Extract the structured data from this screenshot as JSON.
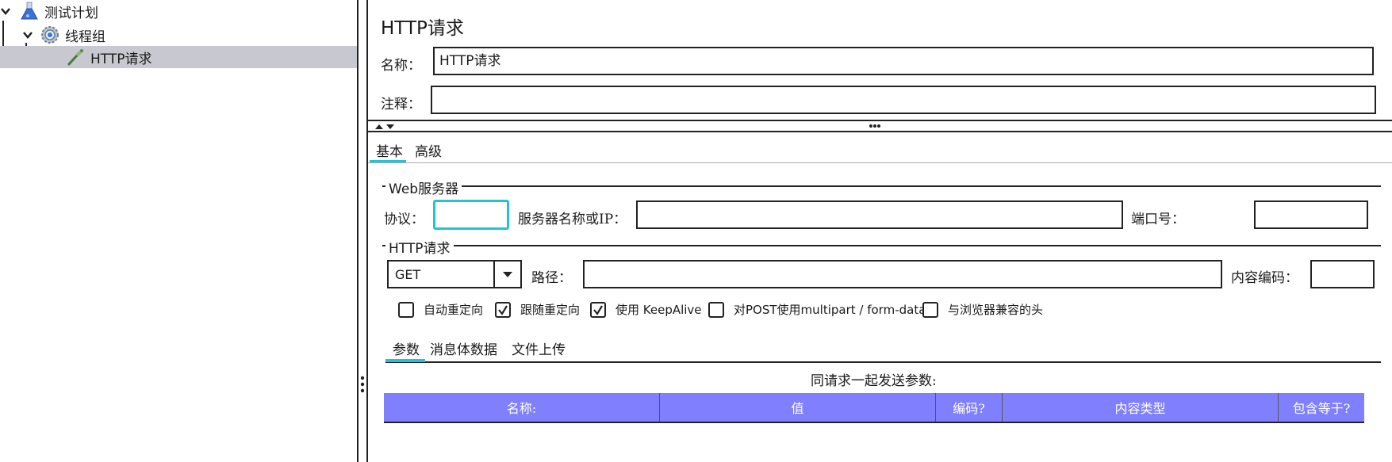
{
  "tree": {
    "items": [
      {
        "label": "测试计划",
        "icon": "flask-icon"
      },
      {
        "label": "线程组",
        "icon": "gear-icon"
      },
      {
        "label": "HTTP请求",
        "icon": "pipette-icon"
      }
    ]
  },
  "panel": {
    "title": "HTTP请求",
    "name_label": "名称：",
    "name_value": "HTTP请求",
    "comment_label": "注释：",
    "comment_value": ""
  },
  "tabs": {
    "main": [
      {
        "label": "基本"
      },
      {
        "label": "高级"
      }
    ],
    "active_main": "基本"
  },
  "web_server": {
    "section_title": "Web服务器",
    "protocol_label": "协议：",
    "protocol_value": "",
    "server_label": "服务器名称或IP：",
    "server_value": "",
    "port_label": "端口号：",
    "port_value": ""
  },
  "http_request": {
    "section_title": "HTTP请求",
    "method": "GET",
    "path_label": "路径：",
    "path_value": "",
    "encoding_label": "内容编码：",
    "encoding_value": ""
  },
  "options": [
    {
      "label": "自动重定向",
      "checked": false
    },
    {
      "label": "跟随重定向",
      "checked": true
    },
    {
      "label": "使用 KeepAlive",
      "checked": true
    },
    {
      "label": "对POST使用multipart / form-data",
      "checked": false
    },
    {
      "label": "与浏览器兼容的头",
      "checked": false
    }
  ],
  "sub_tabs": {
    "items": [
      {
        "label": "参数"
      },
      {
        "label": "消息体数据"
      },
      {
        "label": "文件上传"
      }
    ],
    "active": "参数"
  },
  "params_table": {
    "caption": "同请求一起发送参数:",
    "columns": [
      "名称:",
      "值",
      "编码?",
      "内容类型",
      "包含等于?"
    ],
    "header_color": "#8080ff"
  },
  "colors": {
    "accent": "#22c3d6",
    "selection": "#c8c8d0"
  }
}
